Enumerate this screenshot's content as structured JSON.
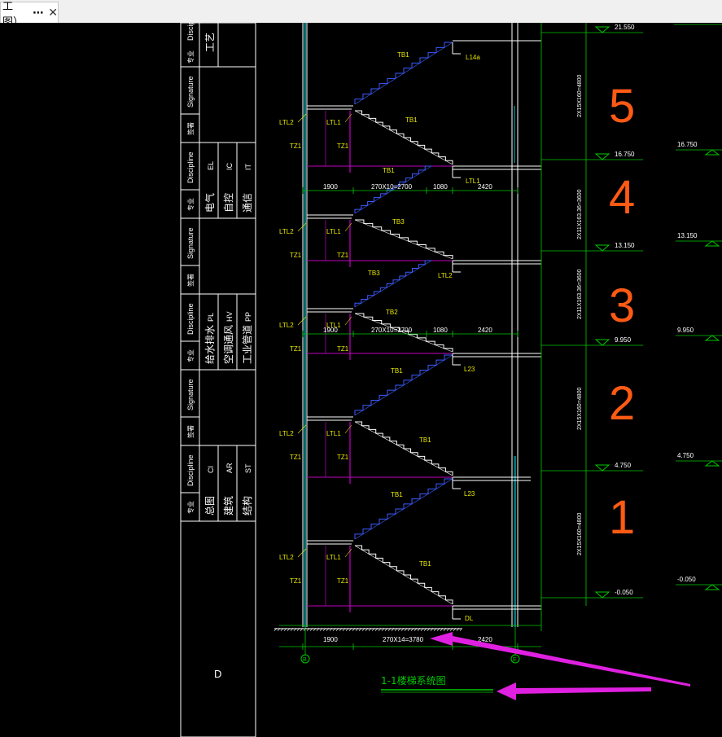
{
  "tab": {
    "title": "工图）",
    "more_icon": "⋯",
    "close_icon": "✕"
  },
  "colors": {
    "background": "#000000",
    "white": "#ffffff",
    "green": "#00c800",
    "yellow": "#e8e800",
    "blue": "#3a5cff",
    "magenta": "#c000c0",
    "cyan": "#00c8c8",
    "orange": "#ff5a14",
    "arrow": "#e020e0"
  },
  "titleblock": {
    "disc_label": "Discipline",
    "sig_label": "Signature",
    "major_label": "专业",
    "sign_label": "签署",
    "top_major": "工艺",
    "group1": [
      {
        "name": "电气",
        "code": "EL"
      },
      {
        "name": "自控",
        "code": "IC"
      },
      {
        "name": "通信",
        "code": "IT"
      }
    ],
    "group2": [
      {
        "name": "给水排水",
        "code": "PL"
      },
      {
        "name": "空调通风",
        "code": "HV"
      },
      {
        "name": "工业管道",
        "code": "PP"
      }
    ],
    "group3": [
      {
        "name": "总图",
        "code": "CI"
      },
      {
        "name": "建筑",
        "code": "AR"
      },
      {
        "name": "结构",
        "code": "ST"
      }
    ],
    "corner_letter": "D"
  },
  "stair": {
    "levels": [
      "21.550",
      "16.750",
      "13.150",
      "9.950",
      "4.750",
      "-0.050"
    ],
    "right_levels": [
      "16.750",
      "13.150",
      "9.950",
      "4.750",
      "-0.050"
    ],
    "flight_dims": [
      "2X15X160=4800",
      "2X11X163.36=3600",
      "2X11X163.36=3600",
      "2X15X160=4800",
      "2X15X160=4800"
    ],
    "floor_numbers": [
      "5",
      "4",
      "3",
      "2",
      "1"
    ],
    "labels": {
      "tb1": "TB1",
      "tb2": "TB2",
      "tb3": "TB3",
      "ltl1": "LTL1",
      "ltl2": "LTL2",
      "tz1": "TZ1",
      "l14a": "L14a",
      "l23": "L23",
      "dl": "DL"
    },
    "dims_upper": {
      "a": "1900",
      "b": "270X10=2700",
      "c": "1080",
      "d": "2420"
    },
    "dims_bottom": {
      "a": "1900",
      "b": "270X14=3780",
      "c": "2420"
    },
    "axis_b": "B",
    "axis_e": "E",
    "drawing_title": "1-1楼梯系统图"
  }
}
